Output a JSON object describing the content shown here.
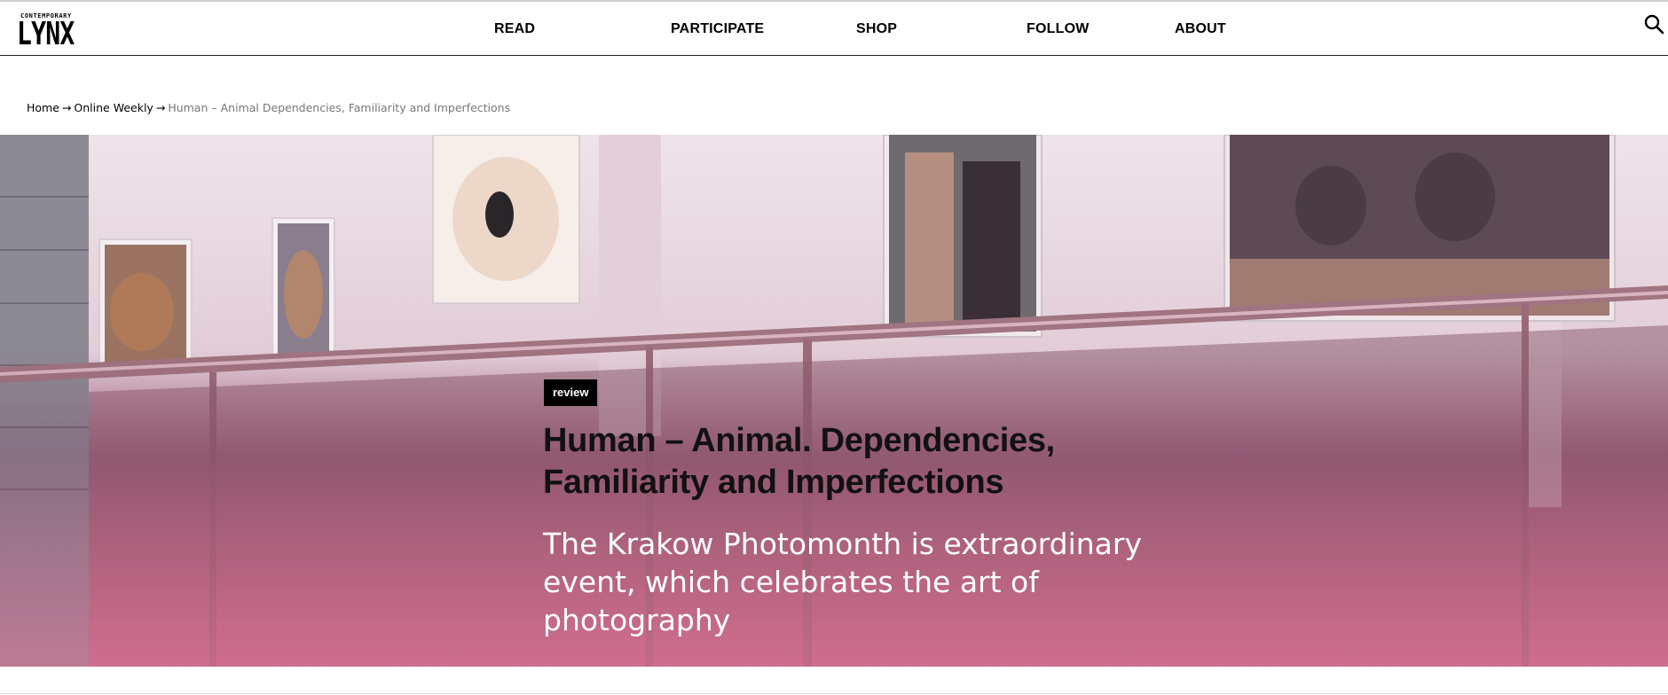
{
  "header": {
    "logo": {
      "small_text": "CONTEMPORARY",
      "big_text": "LYNX"
    },
    "nav": [
      {
        "label": "READ"
      },
      {
        "label": "PARTICIPATE"
      },
      {
        "label": "SHOP"
      },
      {
        "label": "FOLLOW"
      },
      {
        "label": "ABOUT"
      }
    ],
    "search_icon": "search-icon"
  },
  "breadcrumb": {
    "items": [
      {
        "label": "Home"
      },
      {
        "label": "Online Weekly"
      }
    ],
    "separator": "→",
    "current": "Human – Animal Dependencies, Familiarity and Imperfections"
  },
  "hero": {
    "tag": "review",
    "title": "Human – Animal. Dependencies, Familiarity and Imperfections",
    "subtitle": "The Krakow Photomonth is extraordinary event, which celebrates the art of photography",
    "colors": {
      "top": "#efe4ea",
      "bottom": "#e27c9b"
    }
  }
}
